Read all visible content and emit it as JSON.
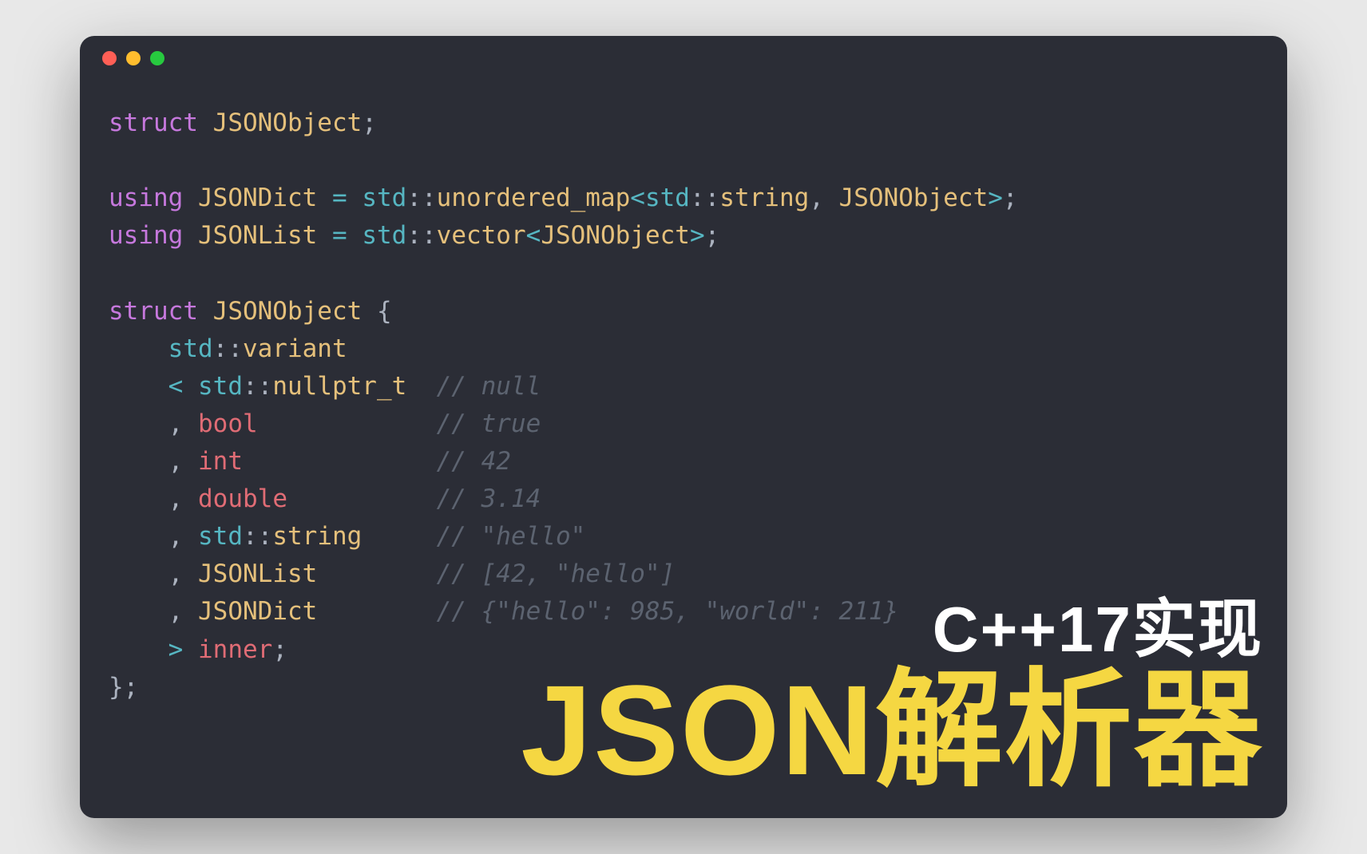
{
  "window": {
    "traffic_lights": [
      "red",
      "yellow",
      "green"
    ]
  },
  "code": {
    "lines": [
      {
        "tokens": [
          {
            "t": "struct",
            "c": "kw"
          },
          {
            "t": " ",
            "c": ""
          },
          {
            "t": "JSONObject",
            "c": "type"
          },
          {
            "t": ";",
            "c": "punct"
          }
        ]
      },
      {
        "tokens": []
      },
      {
        "tokens": [
          {
            "t": "using",
            "c": "kw"
          },
          {
            "t": " ",
            "c": ""
          },
          {
            "t": "JSONDict",
            "c": "type"
          },
          {
            "t": " ",
            "c": ""
          },
          {
            "t": "=",
            "c": "op"
          },
          {
            "t": " ",
            "c": ""
          },
          {
            "t": "std",
            "c": "ns"
          },
          {
            "t": "::",
            "c": "punct"
          },
          {
            "t": "unordered_map",
            "c": "type"
          },
          {
            "t": "<",
            "c": "op"
          },
          {
            "t": "std",
            "c": "ns"
          },
          {
            "t": "::",
            "c": "punct"
          },
          {
            "t": "string",
            "c": "type"
          },
          {
            "t": ", ",
            "c": "punct"
          },
          {
            "t": "JSONObject",
            "c": "type"
          },
          {
            "t": ">",
            "c": "op"
          },
          {
            "t": ";",
            "c": "punct"
          }
        ]
      },
      {
        "tokens": [
          {
            "t": "using",
            "c": "kw"
          },
          {
            "t": " ",
            "c": ""
          },
          {
            "t": "JSONList",
            "c": "type"
          },
          {
            "t": " ",
            "c": ""
          },
          {
            "t": "=",
            "c": "op"
          },
          {
            "t": " ",
            "c": ""
          },
          {
            "t": "std",
            "c": "ns"
          },
          {
            "t": "::",
            "c": "punct"
          },
          {
            "t": "vector",
            "c": "type"
          },
          {
            "t": "<",
            "c": "op"
          },
          {
            "t": "JSONObject",
            "c": "type"
          },
          {
            "t": ">",
            "c": "op"
          },
          {
            "t": ";",
            "c": "punct"
          }
        ]
      },
      {
        "tokens": []
      },
      {
        "tokens": [
          {
            "t": "struct",
            "c": "kw"
          },
          {
            "t": " ",
            "c": ""
          },
          {
            "t": "JSONObject",
            "c": "type"
          },
          {
            "t": " {",
            "c": "punct"
          }
        ]
      },
      {
        "tokens": [
          {
            "t": "    ",
            "c": ""
          },
          {
            "t": "std",
            "c": "ns"
          },
          {
            "t": "::",
            "c": "punct"
          },
          {
            "t": "variant",
            "c": "type"
          }
        ]
      },
      {
        "tokens": [
          {
            "t": "    ",
            "c": ""
          },
          {
            "t": "<",
            "c": "op"
          },
          {
            "t": " ",
            "c": ""
          },
          {
            "t": "std",
            "c": "ns"
          },
          {
            "t": "::",
            "c": "punct"
          },
          {
            "t": "nullptr_t",
            "c": "type"
          },
          {
            "t": "  ",
            "c": ""
          },
          {
            "t": "// null",
            "c": "cm"
          }
        ]
      },
      {
        "tokens": [
          {
            "t": "    ",
            "c": ""
          },
          {
            "t": ",",
            "c": "punct"
          },
          {
            "t": " ",
            "c": ""
          },
          {
            "t": "bool",
            "c": "id"
          },
          {
            "t": "            ",
            "c": ""
          },
          {
            "t": "// true",
            "c": "cm"
          }
        ]
      },
      {
        "tokens": [
          {
            "t": "    ",
            "c": ""
          },
          {
            "t": ",",
            "c": "punct"
          },
          {
            "t": " ",
            "c": ""
          },
          {
            "t": "int",
            "c": "id"
          },
          {
            "t": "             ",
            "c": ""
          },
          {
            "t": "// 42",
            "c": "cm"
          }
        ]
      },
      {
        "tokens": [
          {
            "t": "    ",
            "c": ""
          },
          {
            "t": ",",
            "c": "punct"
          },
          {
            "t": " ",
            "c": ""
          },
          {
            "t": "double",
            "c": "id"
          },
          {
            "t": "          ",
            "c": ""
          },
          {
            "t": "// 3.14",
            "c": "cm"
          }
        ]
      },
      {
        "tokens": [
          {
            "t": "    ",
            "c": ""
          },
          {
            "t": ",",
            "c": "punct"
          },
          {
            "t": " ",
            "c": ""
          },
          {
            "t": "std",
            "c": "ns"
          },
          {
            "t": "::",
            "c": "punct"
          },
          {
            "t": "string",
            "c": "type"
          },
          {
            "t": "     ",
            "c": ""
          },
          {
            "t": "// \"hello\"",
            "c": "cm"
          }
        ]
      },
      {
        "tokens": [
          {
            "t": "    ",
            "c": ""
          },
          {
            "t": ",",
            "c": "punct"
          },
          {
            "t": " ",
            "c": ""
          },
          {
            "t": "JSONList",
            "c": "type"
          },
          {
            "t": "        ",
            "c": ""
          },
          {
            "t": "// [42, \"hello\"]",
            "c": "cm"
          }
        ]
      },
      {
        "tokens": [
          {
            "t": "    ",
            "c": ""
          },
          {
            "t": ",",
            "c": "punct"
          },
          {
            "t": " ",
            "c": ""
          },
          {
            "t": "JSONDict",
            "c": "type"
          },
          {
            "t": "        ",
            "c": ""
          },
          {
            "t": "// {\"hello\": 985, \"world\": 211}",
            "c": "cm"
          }
        ]
      },
      {
        "tokens": [
          {
            "t": "    ",
            "c": ""
          },
          {
            "t": ">",
            "c": "op"
          },
          {
            "t": " ",
            "c": ""
          },
          {
            "t": "inner",
            "c": "id"
          },
          {
            "t": ";",
            "c": "punct"
          }
        ]
      },
      {
        "tokens": [
          {
            "t": "};",
            "c": "punct"
          }
        ]
      }
    ]
  },
  "overlay": {
    "subtitle": "C++17实现",
    "title": "JSON解析器"
  }
}
